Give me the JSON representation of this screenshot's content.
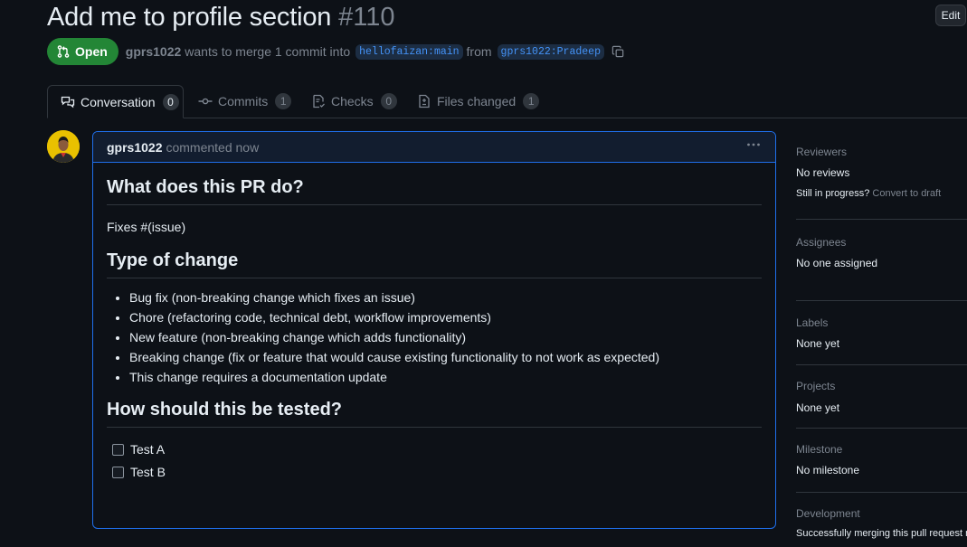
{
  "header": {
    "title": "Add me to profile section",
    "pr_number": "#110",
    "edit_label": "Edit",
    "state_label": "Open",
    "author": "gprs1022",
    "merge_text": "wants to merge 1 commit into",
    "base_branch": "hellofaizan:main",
    "from_text": "from",
    "head_branch": "gprs1022:Pradeep"
  },
  "tabs": [
    {
      "label": "Conversation",
      "count": "0",
      "icon": "comment-discussion-icon"
    },
    {
      "label": "Commits",
      "count": "1",
      "icon": "git-commit-icon"
    },
    {
      "label": "Checks",
      "count": "0",
      "icon": "checklist-icon"
    },
    {
      "label": "Files changed",
      "count": "1",
      "icon": "file-diff-icon"
    }
  ],
  "comment": {
    "author": "gprs1022",
    "time": "commented now",
    "heading1": "What does this PR do?",
    "para1": "Fixes #(issue)",
    "heading2": "Type of change",
    "change_types": [
      "Bug fix (non-breaking change which fixes an issue)",
      "Chore (refactoring code, technical debt, workflow improvements)",
      "New feature (non-breaking change which adds functionality)",
      "Breaking change (fix or feature that would cause existing functionality to not work as expected)",
      "This change requires a documentation update"
    ],
    "heading3": "How should this be tested?",
    "tests": [
      "Test A",
      "Test B"
    ]
  },
  "sidebar": {
    "reviewers": {
      "title": "Reviewers",
      "value": "No reviews",
      "progress_text": "Still in progress?",
      "convert_link": "Convert to draft"
    },
    "assignees": {
      "title": "Assignees",
      "value": "No one assigned"
    },
    "labels": {
      "title": "Labels",
      "value": "None yet"
    },
    "projects": {
      "title": "Projects",
      "value": "None yet"
    },
    "milestone": {
      "title": "Milestone",
      "value": "No milestone"
    },
    "development": {
      "title": "Development",
      "value": "Successfully merging this pull request m"
    }
  },
  "colors": {
    "background": "#0d1117",
    "open_green": "#238636",
    "accent_blue": "#1f6feb",
    "muted": "#7d8590"
  }
}
